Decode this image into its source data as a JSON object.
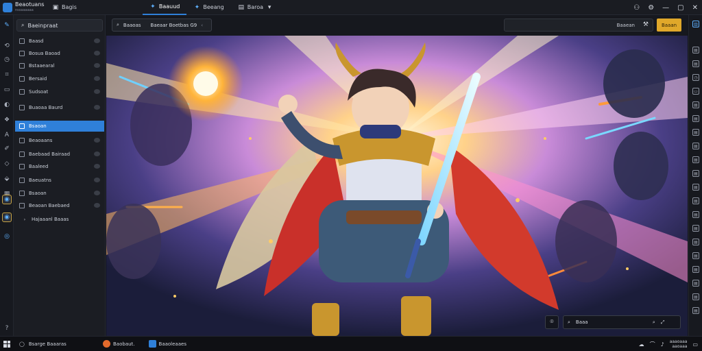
{
  "titlebar": {
    "app_name": "Beaotuans",
    "app_sub": "nssaaaaaa",
    "menu_item": "Bagis",
    "tabs": [
      {
        "label": "Baauud",
        "active": true
      },
      {
        "label": "Beeang",
        "active": false
      },
      {
        "label": "Baroa",
        "active": false
      }
    ]
  },
  "sidebar": {
    "search_label": "Baeinpraat",
    "items": [
      {
        "label": "Baasd",
        "icon": "image-icon"
      },
      {
        "label": "Bosua Baoad",
        "icon": "layer-icon"
      },
      {
        "label": "Bstaaearal",
        "icon": "layer-icon"
      },
      {
        "label": "Bersaid",
        "icon": "layer-icon"
      },
      {
        "label": "Sudsoat",
        "icon": "brush-icon"
      },
      {
        "label": "Buaoaa Baurd",
        "icon": "layer-icon"
      },
      {
        "label": "Bsaoan",
        "icon": "layer-icon",
        "active": true
      },
      {
        "label": "Beaoaans",
        "icon": "layer-icon"
      },
      {
        "label": "Baebaad Bairaad",
        "icon": "layer-icon"
      },
      {
        "label": "Baaleed",
        "icon": "layer-icon"
      },
      {
        "label": "Baeuatns",
        "icon": "layer-icon"
      },
      {
        "label": "Bsaoan",
        "icon": "layer-icon"
      },
      {
        "label": "Beaoan Baebaed",
        "icon": "layer-icon"
      },
      {
        "label": "Hajaaanl Baaas",
        "icon": "chevron-icon",
        "child": true
      }
    ]
  },
  "canvas": {
    "filter_left": "Baaoas",
    "filter_right": "Baeaar Boetbas G9",
    "right_search": "Baaean",
    "gold_button": "Baaan",
    "bottom_search": "Baaa"
  },
  "taskbar": {
    "search": "Bsarge Baaaras",
    "apps": [
      {
        "label": "Baobaut.",
        "color": "#e26a2c"
      },
      {
        "label": "Baaoleaaes",
        "color": "#2f80d9"
      }
    ],
    "clock_line1": "aaaoaaa",
    "clock_line2": "aaoaaa"
  },
  "colors": {
    "accent": "#2f80d9",
    "gold": "#e0a82a"
  }
}
